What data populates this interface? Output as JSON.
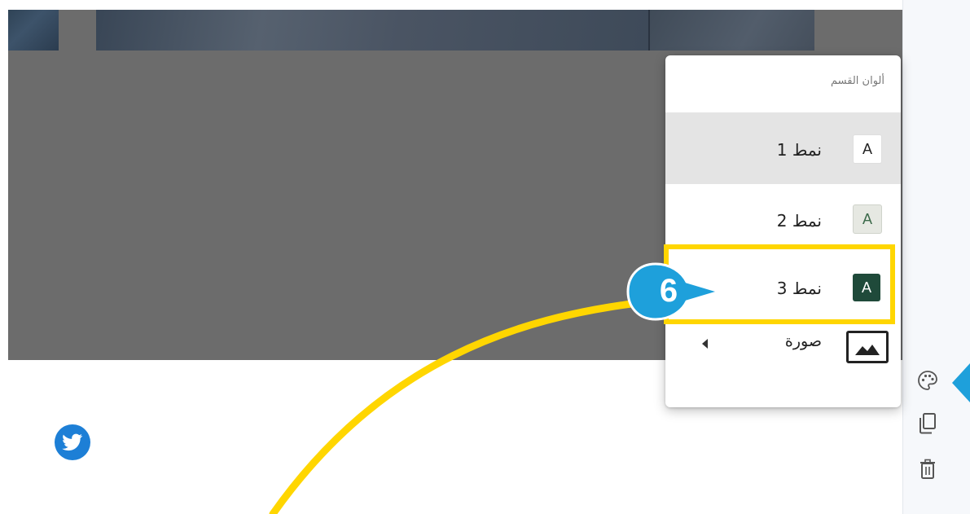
{
  "menu": {
    "title": "ألوان القسم",
    "items": [
      {
        "label": "نمط 1",
        "swatch_letter": "A"
      },
      {
        "label": "نمط 2",
        "swatch_letter": "A"
      },
      {
        "label": "نمط 3",
        "swatch_letter": "A"
      },
      {
        "label": "صورة"
      }
    ],
    "selected_index": 0,
    "highlighted_index": 2
  },
  "callout": {
    "number": "6"
  },
  "rail": {
    "icons": [
      "palette-icon",
      "duplicate-icon",
      "trash-icon"
    ]
  },
  "social": {
    "icon": "twitter-icon"
  },
  "colors": {
    "highlight": "#ffd600",
    "callout": "#1ea0db",
    "swatch_dark": "#1f4a3a",
    "twitter": "#1d7fd6"
  }
}
